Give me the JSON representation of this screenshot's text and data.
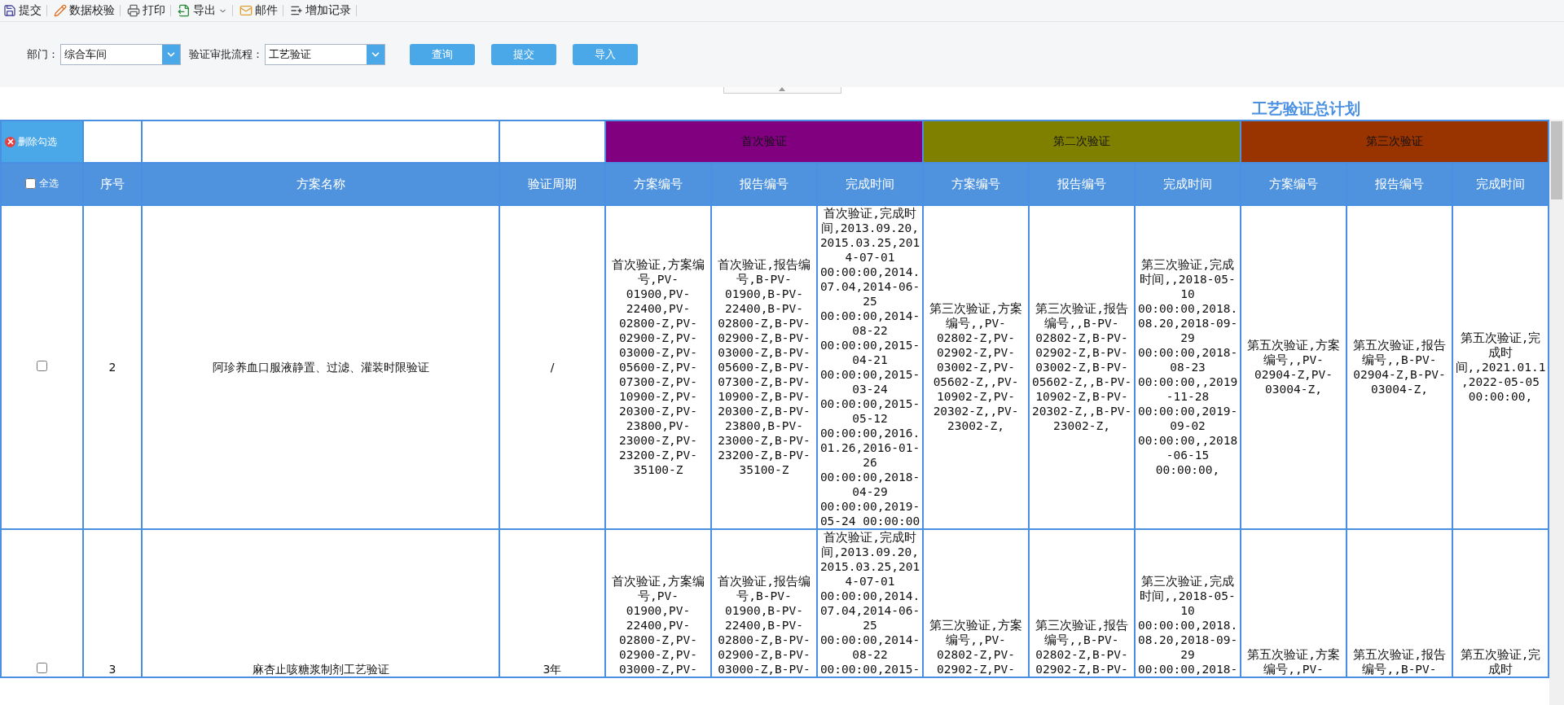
{
  "toolbar": [
    {
      "kind": "save",
      "label": "提交",
      "has_menu": false
    },
    {
      "kind": "validate",
      "label": "数据校验",
      "has_menu": false
    },
    {
      "kind": "print",
      "label": "打印",
      "has_menu": false
    },
    {
      "kind": "export",
      "label": "导出",
      "has_menu": true
    },
    {
      "kind": "mail",
      "label": "邮件",
      "has_menu": false
    },
    {
      "kind": "add",
      "label": "增加记录",
      "has_menu": false
    }
  ],
  "filters": [
    {
      "label": "部门：",
      "value": "综合车间"
    },
    {
      "label": "验证审批流程：",
      "value": "工艺验证"
    }
  ],
  "buttons": [
    "查询",
    "提交",
    "导入"
  ],
  "title": "工艺验证总计划",
  "table": {
    "delete_button": "删除勾选",
    "columns": [
      {
        "kind": "select_all",
        "label": "全选",
        "checked": false
      },
      {
        "kind": "text",
        "label": "序号"
      },
      {
        "kind": "text",
        "label": "方案名称"
      },
      {
        "kind": "text",
        "label": "验证周期"
      },
      {
        "kind": "text",
        "label": "方案编号"
      },
      {
        "kind": "text",
        "label": "报告编号"
      },
      {
        "kind": "text",
        "label": "完成时间"
      },
      {
        "kind": "text",
        "label": "方案编号"
      },
      {
        "kind": "text",
        "label": "报告编号"
      },
      {
        "kind": "text",
        "label": "完成时间"
      },
      {
        "kind": "text",
        "label": "方案编号"
      },
      {
        "kind": "text",
        "label": "报告编号"
      },
      {
        "kind": "text",
        "label": "完成时间"
      }
    ],
    "groups": [
      {
        "label": "首次验证",
        "color": "#800080"
      },
      {
        "label": "第二次验证",
        "color": "#808000"
      },
      {
        "label": "第三次验证",
        "color": "#993300"
      }
    ],
    "rows": [
      {
        "checked": false,
        "cells": [
          "",
          "2",
          "阿珍养血口服液静置、过滤、灌装时限验证",
          "/",
          "首次验证,方案编号,PV-01900,PV-22400,PV-02800-Z,PV-02900-Z,PV-03000-Z,PV-05600-Z,PV-07300-Z,PV-10900-Z,PV-20300-Z,PV-23800,PV-23000-Z,PV-23200-Z,PV-35100-Z",
          "首次验证,报告编号,B-PV-01900,B-PV-22400,B-PV-02800-Z,B-PV-02900-Z,B-PV-03000-Z,B-PV-05600-Z,B-PV-07300-Z,B-PV-10900-Z,B-PV-20300-Z,B-PV-23800,B-PV-23000-Z,B-PV-23200-Z,B-PV-35100-Z",
          "首次验证,完成时间,2013.09.20,2015.03.25,2014-07-01 00:00:00,2014.07.04,2014-06-25 00:00:00,2014-08-22 00:00:00,2015-04-21 00:00:00,2015-03-24 00:00:00,2015-05-12 00:00:00,2016.01.26,2016-01-26 00:00:00,2018-04-29 00:00:00,2019-05-24 00:00:00",
          "第三次验证,方案编号,,PV-02802-Z,PV-02902-Z,PV-03002-Z,PV-05602-Z,,PV-10902-Z,PV-20302-Z,,PV-23002-Z,",
          "第三次验证,报告编号,,B-PV-02802-Z,B-PV-02902-Z,B-PV-03002-Z,B-PV-05602-Z,,B-PV-10902-Z,B-PV-20302-Z,,B-PV-23002-Z,",
          "第三次验证,完成时间,,2018-05-10 00:00:00,2018.08.20,2018-09-29 00:00:00,2018-08-23 00:00:00,,2019-11-28 00:00:00,2019-09-02 00:00:00,,2018-06-15 00:00:00,",
          "第五次验证,方案编号,,PV-02904-Z,PV-03004-Z,",
          "第五次验证,报告编号,,B-PV-02904-Z,B-PV-03004-Z,",
          "第五次验证,完成时间,,2021.01.1,2022-05-05 00:00:00,"
        ]
      },
      {
        "checked": false,
        "cells": [
          "",
          "3",
          "麻杏止咳糖浆制剂工艺验证",
          "3年",
          "首次验证,方案编号,PV-01900,PV-22400,PV-02800-Z,PV-02900-Z,PV-03000-Z,PV-",
          "首次验证,报告编号,B-PV-01900,B-PV-22400,B-PV-02800-Z,B-PV-02900-Z,B-PV-03000-Z,B-PV-",
          "首次验证,完成时间,2013.09.20,2015.03.25,2014-07-01 00:00:00,2014.07.04,2014-06-25 00:00:00,2014-08-22 00:00:00,2015-",
          "第三次验证,方案编号,,PV-02802-Z,PV-02902-Z,PV-",
          "第三次验证,报告编号,,B-PV-02802-Z,B-PV-02902-Z,B-PV-",
          "第三次验证,完成时间,,2018-05-10 00:00:00,2018.08.20,2018-09-29 00:00:00,2018-",
          "第五次验证,方案编号,,PV-",
          "第五次验证,报告编号,,B-PV-",
          "第五次验证,完成时"
        ]
      }
    ]
  }
}
